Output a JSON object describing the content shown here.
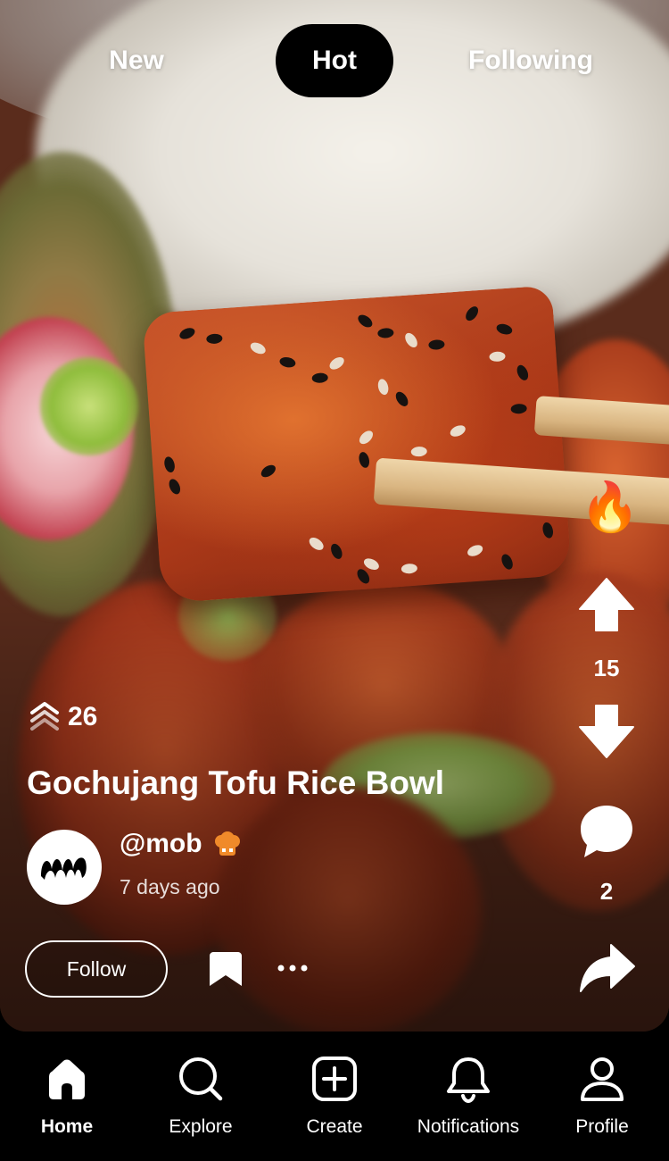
{
  "feed_tabs": [
    {
      "label": "New",
      "active": false
    },
    {
      "label": "Hot",
      "active": true
    },
    {
      "label": "Following",
      "active": false
    }
  ],
  "post": {
    "stack_count": "26",
    "title": "Gochujang Tofu Rice Bowl",
    "author": {
      "username": "@mob",
      "time_ago": "7 days ago",
      "badge_icon": "chef-hat-icon"
    },
    "follow_label": "Follow",
    "hot_icon": "fire-emoji"
  },
  "actions": {
    "upvote_icon": "arrow-up-icon",
    "vote_score": "15",
    "downvote_icon": "arrow-down-icon",
    "comment_icon": "comment-bubble-icon",
    "comment_count": "2",
    "share_icon": "share-arrow-icon"
  },
  "bottom_nav": [
    {
      "label": "Home",
      "icon": "home-icon",
      "active": true
    },
    {
      "label": "Explore",
      "icon": "search-icon",
      "active": false
    },
    {
      "label": "Create",
      "icon": "plus-square-icon",
      "active": false
    },
    {
      "label": "Notifications",
      "icon": "bell-icon",
      "active": false
    },
    {
      "label": "Profile",
      "icon": "person-icon",
      "active": false
    }
  ],
  "colors": {
    "background": "#000000",
    "text": "#ffffff",
    "badge": "#f08a2a"
  }
}
